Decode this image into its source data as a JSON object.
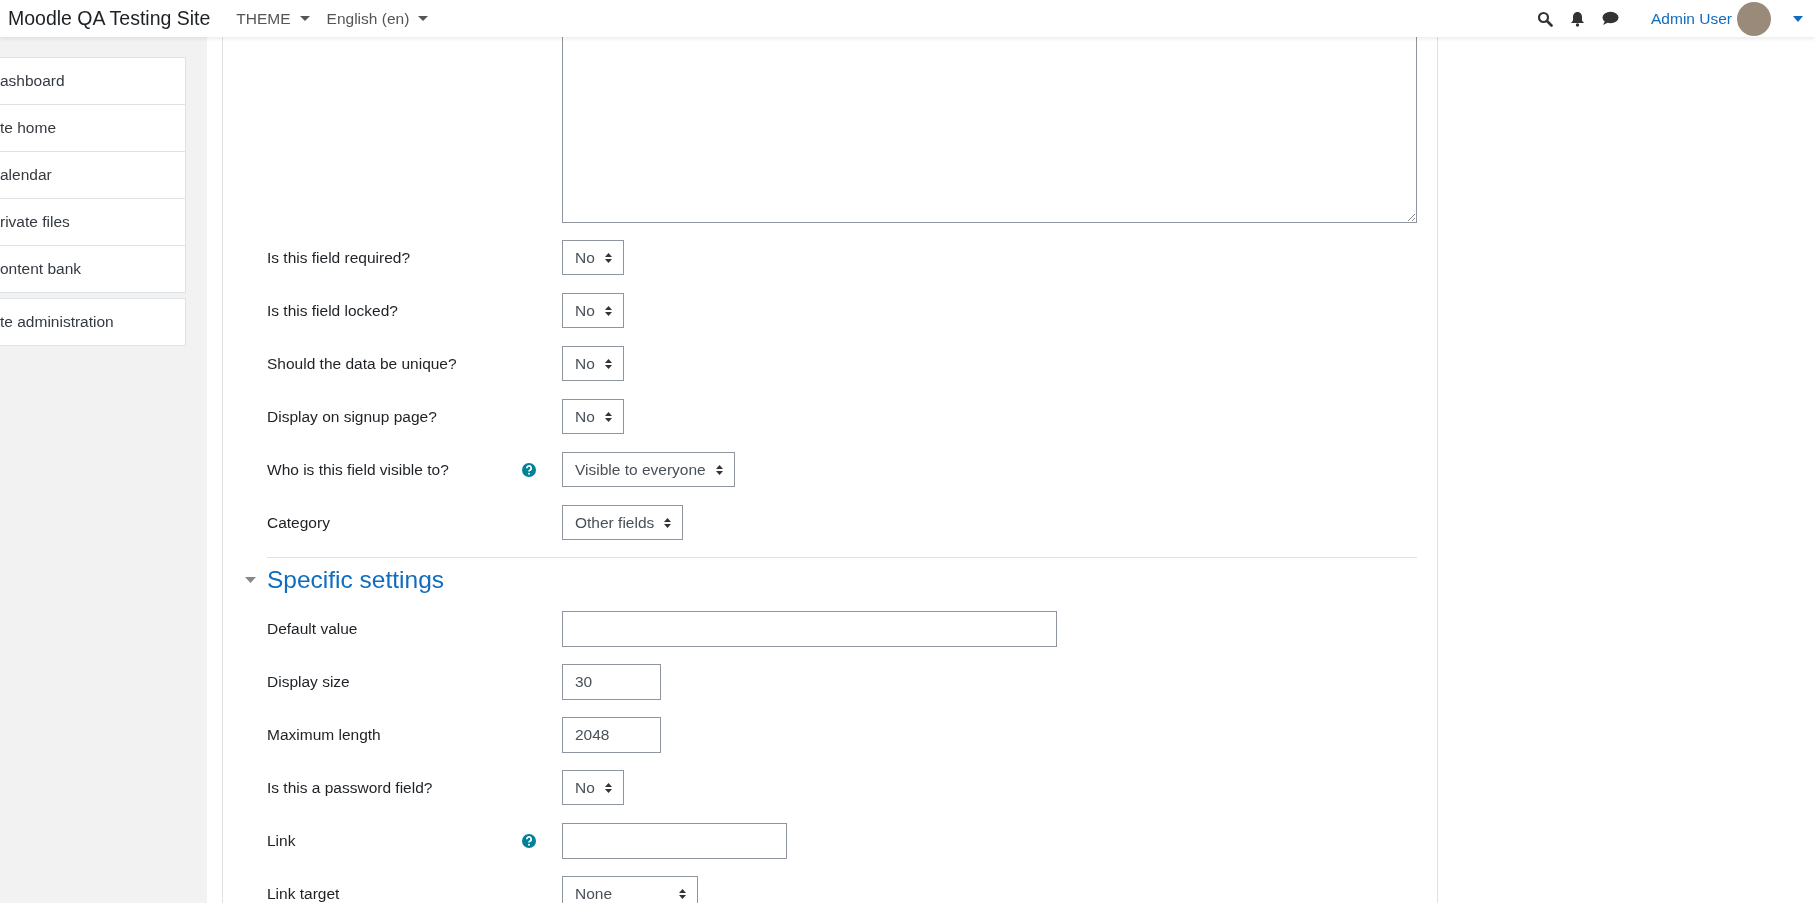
{
  "navbar": {
    "site_name": "Moodle QA Testing Site",
    "menus": [
      "THEME",
      "English (en)"
    ],
    "user_name": "Admin User"
  },
  "sidebar": {
    "groups": [
      [
        "ashboard",
        "te home",
        "alendar",
        "rivate files",
        "ontent bank"
      ],
      [
        "te administration"
      ]
    ]
  },
  "general_rows": [
    {
      "kind": "select",
      "label": "Is this field required?",
      "value": "No",
      "help": false
    },
    {
      "kind": "select",
      "label": "Is this field locked?",
      "value": "No",
      "help": false
    },
    {
      "kind": "select",
      "label": "Should the data be unique?",
      "value": "No",
      "help": false
    },
    {
      "kind": "select",
      "label": "Display on signup page?",
      "value": "No",
      "help": false
    },
    {
      "kind": "select",
      "label": "Who is this field visible to?",
      "value": "Visible to everyone",
      "help": true
    },
    {
      "kind": "select",
      "label": "Category",
      "value": "Other fields",
      "help": false
    }
  ],
  "section": {
    "title": "Specific settings",
    "expanded": true
  },
  "specific_rows": [
    {
      "kind": "text",
      "label": "Default value",
      "value": "",
      "help": false
    },
    {
      "kind": "text",
      "label": "Display size",
      "value": "30",
      "help": false
    },
    {
      "kind": "text",
      "label": "Maximum length",
      "value": "2048",
      "help": false
    },
    {
      "kind": "select",
      "label": "Is this a password field?",
      "value": "No",
      "help": false
    },
    {
      "kind": "text",
      "label": "Link",
      "value": "",
      "help": true
    },
    {
      "kind": "select",
      "label": "Link target",
      "value": "None",
      "help": false
    }
  ]
}
